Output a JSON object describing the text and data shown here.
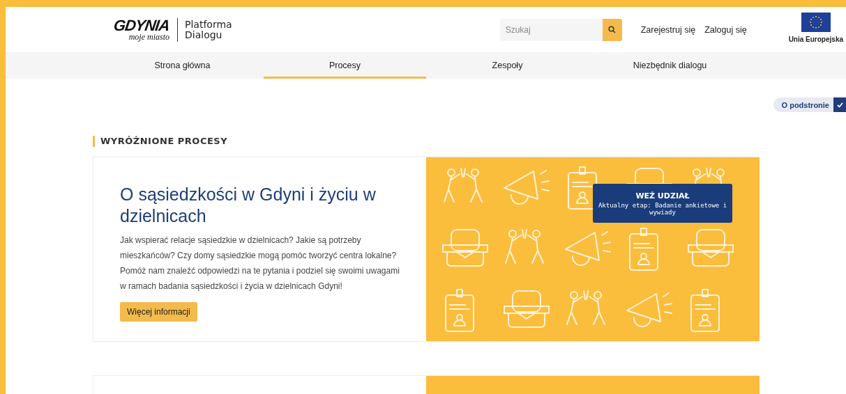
{
  "header": {
    "logo": {
      "wordmark": "GDYNIA",
      "tagline": "moje miasto"
    },
    "platform_name": [
      "Platforma",
      "Dialogu"
    ],
    "search": {
      "placeholder": "Szukaj"
    },
    "links": [
      "Zarejestruj się",
      "Zaloguj się"
    ],
    "eu_label": "Unia Europejska"
  },
  "nav": [
    {
      "label": "Strona główna",
      "selected": false
    },
    {
      "label": "Procesy",
      "selected": true
    },
    {
      "label": "Zespoły",
      "selected": false
    },
    {
      "label": "Niezbędnik dialogu",
      "selected": false
    }
  ],
  "page_info_toggle": {
    "label": "O podstronie",
    "checked": true
  },
  "section_title": "WYRÓŻNIONE PROCESY",
  "featured": {
    "title": "O sąsiedzkości w Gdyni i życiu w dzielnicach",
    "description": "Jak wspierać relacje sąsiedzkie w dzielnicach? Jakie są potrzeby mieszkańców? Czy domy sąsiedzkie mogą pomóc tworzyć centra lokalne? Pomóż nam znaleźć odpowiedzi na te pytania i podziel się swoimi uwagami w ramach badania sąsiedzkości i życia w dzielnicach Gdyni!",
    "button": "Więcej informacji",
    "badge": {
      "title": "WEŹ UDZIAŁ",
      "stage": "Aktualny etap: Badanie ankietowe i wywiady"
    }
  }
}
